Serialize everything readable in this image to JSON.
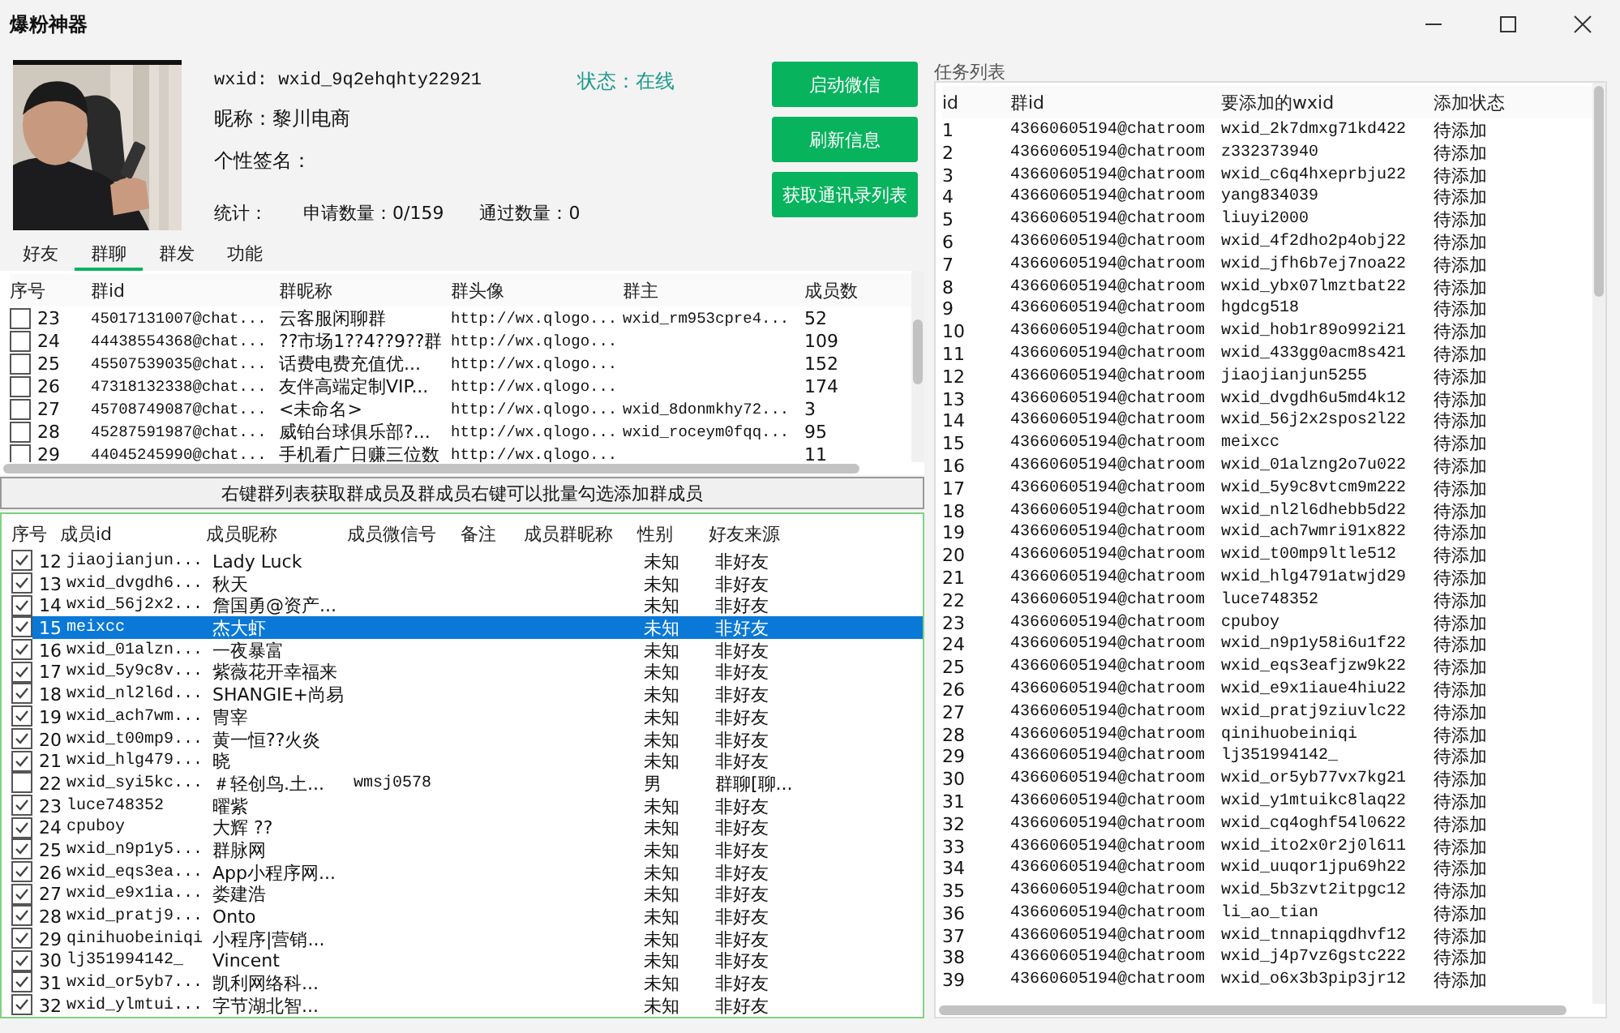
{
  "window": {
    "title": "爆粉神器"
  },
  "profile": {
    "wxid": "wxid: wxid_9q2ehqhty22921",
    "status": "状态：在线",
    "nickname": "昵称：黎川电商",
    "signature": "个性签名：",
    "stats_label": "统计：",
    "requests": "申请数量：0/159",
    "passed": "通过数量：0"
  },
  "actions": [
    "启动微信",
    "刷新信息",
    "获取通讯录列表"
  ],
  "tabs": [
    {
      "label": "好友",
      "selected": false
    },
    {
      "label": "群聊",
      "selected": true
    },
    {
      "label": "群发",
      "selected": false
    },
    {
      "label": "功能",
      "selected": false
    }
  ],
  "groups": {
    "columns": [
      "序号",
      "群id",
      "群昵称",
      "群头像",
      "群主",
      "成员数"
    ],
    "rows": [
      {
        "checked": false,
        "no": "23",
        "id": "45017131007@chat...",
        "name": "云客服闲聊群",
        "avatar": "http://wx.qlogo...",
        "owner": "wxid_rm953cpre4...",
        "count": "52"
      },
      {
        "checked": false,
        "no": "24",
        "id": "44438554368@chat...",
        "name": "??市场1??4??9??群",
        "avatar": "http://wx.qlogo...",
        "count": "109"
      },
      {
        "checked": false,
        "no": "25",
        "id": "45507539035@chat...",
        "name": "话费电费充值优...",
        "avatar": "http://wx.qlogo...",
        "count": "152"
      },
      {
        "checked": false,
        "no": "26",
        "id": "47318132338@chat...",
        "name": "友伴高端定制VIP...",
        "avatar": "http://wx.qlogo...",
        "count": "174"
      },
      {
        "checked": false,
        "no": "27",
        "id": "45708749087@chat...",
        "name": "<未命名>",
        "avatar": "http://wx.qlogo...",
        "owner": "wxid_8donmkhy72...",
        "count": "3"
      },
      {
        "checked": false,
        "no": "28",
        "id": "45287591987@chat...",
        "name": "威铂台球俱乐部?...",
        "avatar": "http://wx.qlogo...",
        "owner": "wxid_roceym0fqq...",
        "count": "95"
      },
      {
        "checked": false,
        "no": "29",
        "id": "44045245990@chat...",
        "name": "手机看广日赚三位数",
        "avatar": "http://wx.qlogo...",
        "count": "11"
      }
    ]
  },
  "hint": "右键群列表获取群成员及群成员右键可以批量勾选添加群成员",
  "members": {
    "columns": [
      "序号",
      "成员id",
      "成员昵称",
      "成员微信号",
      "备注",
      "成员群昵称",
      "性别",
      "好友来源"
    ],
    "rows": [
      {
        "checked": true,
        "selected": false,
        "no": "12",
        "id": "jiaojianjun...",
        "nickname": "Lady Luck",
        "gender": "未知",
        "source": "非好友"
      },
      {
        "checked": true,
        "selected": false,
        "no": "13",
        "id": "wxid_dvgdh6...",
        "nickname": "秋天",
        "gender": "未知",
        "source": "非好友"
      },
      {
        "checked": true,
        "selected": false,
        "no": "14",
        "id": "wxid_56j2x2...",
        "nickname": "詹国勇@资产...",
        "gender": "未知",
        "source": "非好友"
      },
      {
        "checked": true,
        "selected": true,
        "no": "15",
        "id": "meixcc",
        "nickname": "杰大虾",
        "gender": "未知",
        "source": "非好友"
      },
      {
        "checked": true,
        "selected": false,
        "no": "16",
        "id": "wxid_01alzn...",
        "nickname": "一夜暴富",
        "gender": "未知",
        "source": "非好友"
      },
      {
        "checked": true,
        "selected": false,
        "no": "17",
        "id": "wxid_5y9c8v...",
        "nickname": "紫薇花开幸福来",
        "gender": "未知",
        "source": "非好友"
      },
      {
        "checked": true,
        "selected": false,
        "no": "18",
        "id": "wxid_nl2l6d...",
        "nickname": "SHANGIE+尚易",
        "gender": "未知",
        "source": "非好友"
      },
      {
        "checked": true,
        "selected": false,
        "no": "19",
        "id": "wxid_ach7wm...",
        "nickname": "冑宰",
        "gender": "未知",
        "source": "非好友"
      },
      {
        "checked": true,
        "selected": false,
        "no": "20",
        "id": "wxid_t00mp9...",
        "nickname": "黄一恒??火炎",
        "gender": "未知",
        "source": "非好友"
      },
      {
        "checked": true,
        "selected": false,
        "no": "21",
        "id": "wxid_hlg479...",
        "nickname": "晓",
        "gender": "未知",
        "source": "非好友"
      },
      {
        "checked": false,
        "selected": false,
        "no": "22",
        "id": "wxid_syi5kc...",
        "nickname": "＃轻创鸟.土...",
        "wechat_id": "wmsj0578",
        "gender": "男",
        "source": "群聊[聊..."
      },
      {
        "checked": true,
        "selected": false,
        "no": "23",
        "id": "luce748352",
        "nickname": "曜紫",
        "gender": "未知",
        "source": "非好友"
      },
      {
        "checked": true,
        "selected": false,
        "no": "24",
        "id": "cpuboy",
        "nickname": "大辉 ??",
        "gender": "未知",
        "source": "非好友"
      },
      {
        "checked": true,
        "selected": false,
        "no": "25",
        "id": "wxid_n9p1y5...",
        "nickname": "群脉网",
        "gender": "未知",
        "source": "非好友"
      },
      {
        "checked": true,
        "selected": false,
        "no": "26",
        "id": "wxid_eqs3ea...",
        "nickname": "App小程序网...",
        "gender": "未知",
        "source": "非好友"
      },
      {
        "checked": true,
        "selected": false,
        "no": "27",
        "id": "wxid_e9x1ia...",
        "nickname": "娄建浩",
        "gender": "未知",
        "source": "非好友"
      },
      {
        "checked": true,
        "selected": false,
        "no": "28",
        "id": "wxid_pratj9...",
        "nickname": "Onto",
        "gender": "未知",
        "source": "非好友"
      },
      {
        "checked": true,
        "selected": false,
        "no": "29",
        "id": "qinihuobeiniqi",
        "nickname": "小程序|营销...",
        "gender": "未知",
        "source": "非好友"
      },
      {
        "checked": true,
        "selected": false,
        "no": "30",
        "id": "lj351994142_",
        "nickname": "Vincent",
        "gender": "未知",
        "source": "非好友"
      },
      {
        "checked": true,
        "selected": false,
        "no": "31",
        "id": "wxid_or5yb7...",
        "nickname": "凯利网络科...",
        "gender": "未知",
        "source": "非好友"
      },
      {
        "checked": true,
        "selected": false,
        "no": "32",
        "id": "wxid_ylmtui...",
        "nickname": "字节湖北智...",
        "gender": "未知",
        "source": "非好友"
      }
    ]
  },
  "tasks": {
    "title": "任务列表",
    "columns": [
      "id",
      "群id",
      "要添加的wxid",
      "添加状态"
    ],
    "rows": [
      {
        "id": "1",
        "group_id": "43660605194@chatroom",
        "wxid": "wxid_2k7dmxg71kd422",
        "status": "待添加"
      },
      {
        "id": "2",
        "group_id": "43660605194@chatroom",
        "wxid": "z332373940",
        "status": "待添加"
      },
      {
        "id": "3",
        "group_id": "43660605194@chatroom",
        "wxid": "wxid_c6q4hxeprbju22",
        "status": "待添加"
      },
      {
        "id": "4",
        "group_id": "43660605194@chatroom",
        "wxid": "yang834039",
        "status": "待添加"
      },
      {
        "id": "5",
        "group_id": "43660605194@chatroom",
        "wxid": "liuyi2000",
        "status": "待添加"
      },
      {
        "id": "6",
        "group_id": "43660605194@chatroom",
        "wxid": "wxid_4f2dho2p4obj22",
        "status": "待添加"
      },
      {
        "id": "7",
        "group_id": "43660605194@chatroom",
        "wxid": "wxid_jfh6b7ej7noa22",
        "status": "待添加"
      },
      {
        "id": "8",
        "group_id": "43660605194@chatroom",
        "wxid": "wxid_ybx07lmztbat22",
        "status": "待添加"
      },
      {
        "id": "9",
        "group_id": "43660605194@chatroom",
        "wxid": "hgdcg518",
        "status": "待添加"
      },
      {
        "id": "10",
        "group_id": "43660605194@chatroom",
        "wxid": "wxid_hob1r89o992i21",
        "status": "待添加"
      },
      {
        "id": "11",
        "group_id": "43660605194@chatroom",
        "wxid": "wxid_433gg0acm8s421",
        "status": "待添加"
      },
      {
        "id": "12",
        "group_id": "43660605194@chatroom",
        "wxid": "jiaojianjun5255",
        "status": "待添加"
      },
      {
        "id": "13",
        "group_id": "43660605194@chatroom",
        "wxid": "wxid_dvgdh6u5md4k12",
        "status": "待添加"
      },
      {
        "id": "14",
        "group_id": "43660605194@chatroom",
        "wxid": "wxid_56j2x2spos2l22",
        "status": "待添加"
      },
      {
        "id": "15",
        "group_id": "43660605194@chatroom",
        "wxid": "meixcc",
        "status": "待添加"
      },
      {
        "id": "16",
        "group_id": "43660605194@chatroom",
        "wxid": "wxid_01alzng2o7u022",
        "status": "待添加"
      },
      {
        "id": "17",
        "group_id": "43660605194@chatroom",
        "wxid": "wxid_5y9c8vtcm9m222",
        "status": "待添加"
      },
      {
        "id": "18",
        "group_id": "43660605194@chatroom",
        "wxid": "wxid_nl2l6dhebb5d22",
        "status": "待添加"
      },
      {
        "id": "19",
        "group_id": "43660605194@chatroom",
        "wxid": "wxid_ach7wmri91x822",
        "status": "待添加"
      },
      {
        "id": "20",
        "group_id": "43660605194@chatroom",
        "wxid": "wxid_t00mp9ltle512",
        "status": "待添加"
      },
      {
        "id": "21",
        "group_id": "43660605194@chatroom",
        "wxid": "wxid_hlg4791atwjd29",
        "status": "待添加"
      },
      {
        "id": "22",
        "group_id": "43660605194@chatroom",
        "wxid": "luce748352",
        "status": "待添加"
      },
      {
        "id": "23",
        "group_id": "43660605194@chatroom",
        "wxid": "cpuboy",
        "status": "待添加"
      },
      {
        "id": "24",
        "group_id": "43660605194@chatroom",
        "wxid": "wxid_n9p1y58i6u1f22",
        "status": "待添加"
      },
      {
        "id": "25",
        "group_id": "43660605194@chatroom",
        "wxid": "wxid_eqs3eafjzw9k22",
        "status": "待添加"
      },
      {
        "id": "26",
        "group_id": "43660605194@chatroom",
        "wxid": "wxid_e9x1iaue4hiu22",
        "status": "待添加"
      },
      {
        "id": "27",
        "group_id": "43660605194@chatroom",
        "wxid": "wxid_pratj9ziuvlc22",
        "status": "待添加"
      },
      {
        "id": "28",
        "group_id": "43660605194@chatroom",
        "wxid": "qinihuobeiniqi",
        "status": "待添加"
      },
      {
        "id": "29",
        "group_id": "43660605194@chatroom",
        "wxid": "lj351994142_",
        "status": "待添加"
      },
      {
        "id": "30",
        "group_id": "43660605194@chatroom",
        "wxid": "wxid_or5yb77vx7kg21",
        "status": "待添加"
      },
      {
        "id": "31",
        "group_id": "43660605194@chatroom",
        "wxid": "wxid_y1mtuikc8laq22",
        "status": "待添加"
      },
      {
        "id": "32",
        "group_id": "43660605194@chatroom",
        "wxid": "wxid_cq4oghf54l0622",
        "status": "待添加"
      },
      {
        "id": "33",
        "group_id": "43660605194@chatroom",
        "wxid": "wxid_ito2x0r2j0l611",
        "status": "待添加"
      },
      {
        "id": "34",
        "group_id": "43660605194@chatroom",
        "wxid": "wxid_uuqor1jpu69h22",
        "status": "待添加"
      },
      {
        "id": "35",
        "group_id": "43660605194@chatroom",
        "wxid": "wxid_5b3zvt2itpgc12",
        "status": "待添加"
      },
      {
        "id": "36",
        "group_id": "43660605194@chatroom",
        "wxid": "li_ao_tian",
        "status": "待添加"
      },
      {
        "id": "37",
        "group_id": "43660605194@chatroom",
        "wxid": "wxid_tnnapiqgdhvf12",
        "status": "待添加"
      },
      {
        "id": "38",
        "group_id": "43660605194@chatroom",
        "wxid": "wxid_j4p7vz6gstc222",
        "status": "待添加"
      },
      {
        "id": "39",
        "group_id": "43660605194@chatroom",
        "wxid": "wxid_o6x3b3pip3jr12",
        "status": "待添加"
      }
    ]
  }
}
